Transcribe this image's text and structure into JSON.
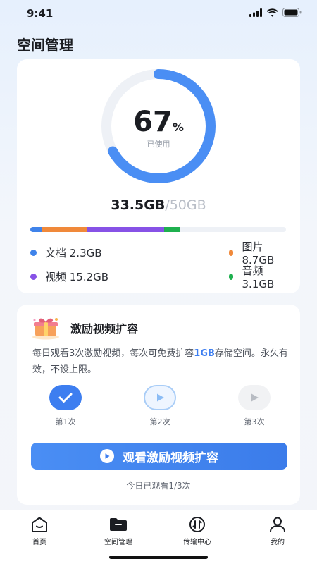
{
  "status_bar": {
    "time": "9:41"
  },
  "page": {
    "title": "空间管理"
  },
  "usage": {
    "percent": 67,
    "percent_value": "67",
    "percent_unit": "%",
    "used_label": "已使用",
    "used": "33.5GB",
    "total": "/50GB",
    "segments": [
      {
        "key": "documents",
        "label": "文档 2.3GB",
        "gb": 2.3,
        "color": "#3f83ea"
      },
      {
        "key": "images",
        "label": "图片 8.7GB",
        "gb": 8.7,
        "color": "#f0893a"
      },
      {
        "key": "videos",
        "label": "视频 15.2GB",
        "gb": 15.2,
        "color": "#8752e6"
      },
      {
        "key": "audio",
        "label": "音频 3.1GB",
        "gb": 3.1,
        "color": "#1fb04f"
      }
    ],
    "capacity_gb": 50,
    "ring_color": "#4a8ef4",
    "ring_track_color": "#eef1f6"
  },
  "reward": {
    "title": "激励视频扩容",
    "desc_before": "每日观看3次激励视频，每次可免费扩容",
    "desc_highlight": "1GB",
    "desc_after": "存储空间。永久有效，不设上限。",
    "steps": [
      {
        "label": "第1次",
        "state": "done"
      },
      {
        "label": "第2次",
        "state": "current"
      },
      {
        "label": "第3次",
        "state": "locked"
      }
    ],
    "button_label": "观看激励视频扩容",
    "progress_text": "今日已观看1/3次",
    "accent_color": "#3d7ef0"
  },
  "tabs": [
    {
      "key": "home",
      "label": "首页",
      "icon": "home-icon"
    },
    {
      "key": "space",
      "label": "空间管理",
      "icon": "folder-icon",
      "active": true
    },
    {
      "key": "transfer",
      "label": "传输中心",
      "icon": "transfer-icon"
    },
    {
      "key": "mine",
      "label": "我的",
      "icon": "user-icon"
    }
  ]
}
